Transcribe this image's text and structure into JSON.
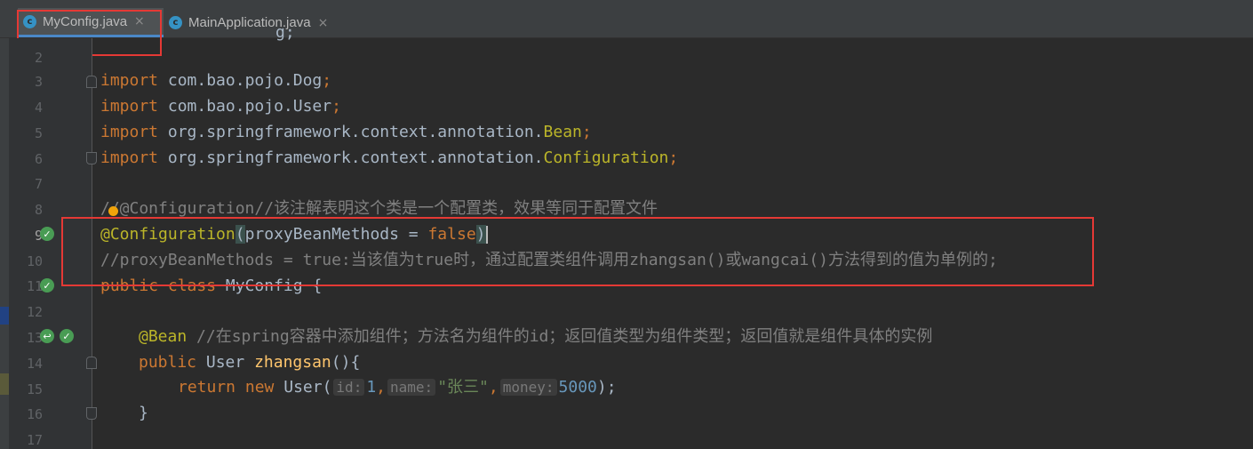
{
  "tabs": [
    {
      "label": "MyConfig.java",
      "icon": "class-icon",
      "active": true
    },
    {
      "label": "MainApplication.java",
      "icon": "spring-class-icon",
      "active": false
    }
  ],
  "line_numbers": [
    "2",
    "3",
    "4",
    "5",
    "6",
    "7",
    "8",
    "9",
    "10",
    "11",
    "12",
    "13",
    "14",
    "15",
    "16",
    "17"
  ],
  "code": {
    "top_partial": "g;",
    "l3_kw": "import",
    "l3_rest": " com.bao.pojo.Dog",
    "l3_semi": ";",
    "l4_kw": "import",
    "l4_rest": " com.bao.pojo.User",
    "l4_semi": ";",
    "l5_kw": "import",
    "l5_rest": " org.springframework.context.annotation.",
    "l5_cls": "Bean",
    "l5_semi": ";",
    "l6_kw": "import",
    "l6_rest": " org.springframework.context.annotation.",
    "l6_cls": "Configuration",
    "l6_semi": ";",
    "l8": "//@Configuration//该注解表明这个类是一个配置类，效果等同于配置文件",
    "l9_ann": "@Configuration",
    "l9_open": "(",
    "l9_param": "proxyBeanMethods = ",
    "l9_val": "false",
    "l9_close": ")",
    "l10": "//proxyBeanMethods = true:当该值为true时，通过配置类组件调用zhangsan()或wangcai()方法得到的值为单例的;",
    "l11_kw": "public class",
    "l11_rest": " MyConfig {",
    "l13_ann": "@Bean",
    "l13_cmt": " //在spring容器中添加组件；方法名为组件的id；返回值类型为组件类型；返回值就是组件具体的实例",
    "l14_kw": "public",
    "l14_type": " User ",
    "l14_fn": "zhangsan",
    "l14_rest": "(){",
    "l15_kw1": "return",
    "l15_kw2": " new",
    "l15_cls": " User(",
    "l15_hint1": "id:",
    "l15_num1": "1",
    "l15_comma1": ",",
    "l15_hint2": "name:",
    "l15_str": "\"张三\"",
    "l15_comma2": ",",
    "l15_hint3": "money:",
    "l15_num2": "5000",
    "l15_end": ");",
    "l16": "}"
  },
  "colors": {
    "keyword": "#cc7832",
    "annotation": "#bbb529",
    "comment": "#808080",
    "string": "#6a8759",
    "number": "#6897bb",
    "highlight_box": "#e53935"
  }
}
